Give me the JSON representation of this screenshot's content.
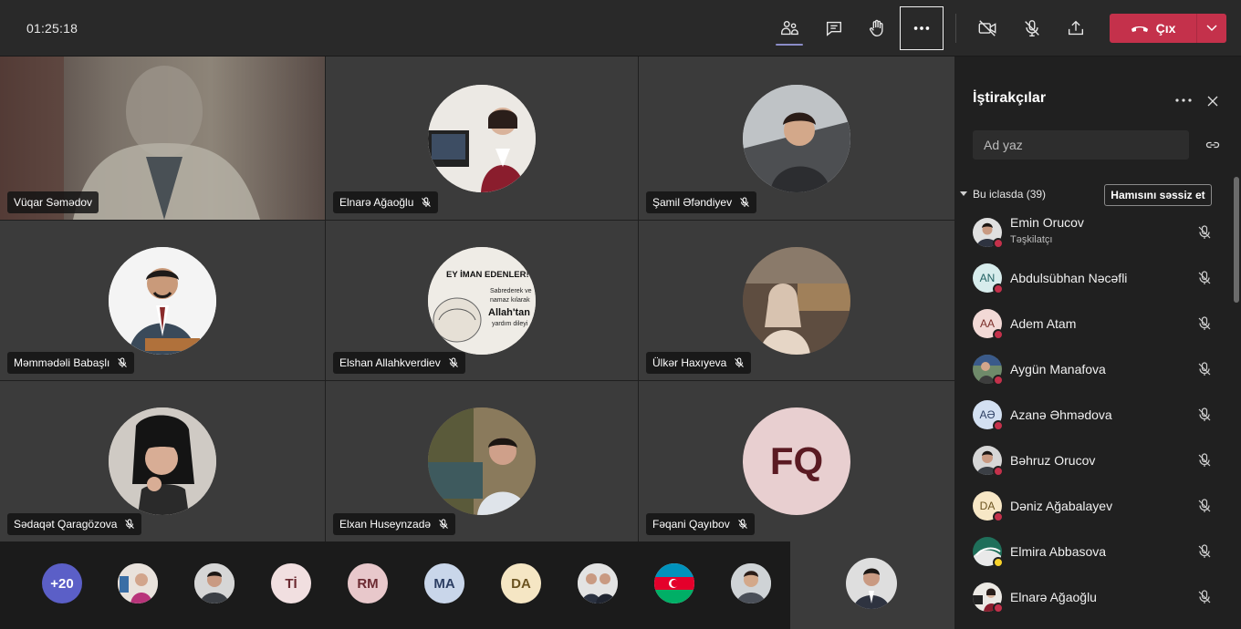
{
  "toolbar": {
    "timer": "01:25:18",
    "leave_label": "Çıx"
  },
  "tiles": [
    {
      "name": "Vüqar Səmədov",
      "type": "video",
      "muted": false
    },
    {
      "name": "Elnarə Ağaoğlu",
      "type": "photo",
      "muted": true
    },
    {
      "name": "Şamil Əfəndiyev",
      "type": "photo",
      "muted": true
    },
    {
      "name": "Məmmədəli Babaşlı",
      "type": "photo",
      "muted": true
    },
    {
      "name": "Elshan Allahkverdiev",
      "type": "photo",
      "muted": true
    },
    {
      "name": "Ülkər Haxıyeva",
      "type": "photo",
      "muted": true
    },
    {
      "name": "Sədaqət Qaragözova",
      "type": "photo",
      "muted": true
    },
    {
      "name": "Elxan Huseynzadə",
      "type": "photo",
      "muted": true
    },
    {
      "name": "Fəqani Qayıbov",
      "type": "initials",
      "initials": "FQ",
      "muted": true
    }
  ],
  "tile_graphics": {
    "poster_line1": "EY İMAN EDENLER!",
    "poster_line2": "Sabrederek ve",
    "poster_line3": "namaz kılarak",
    "poster_line4": "Allah'tan",
    "poster_line5": "yardım dileyi"
  },
  "strip": {
    "overflow_label": "+20",
    "avatars": [
      {
        "kind": "photo"
      },
      {
        "kind": "photo"
      },
      {
        "kind": "initials",
        "text": "Tİ",
        "bg": "#f1dfe0",
        "fg": "#6b2a31"
      },
      {
        "kind": "initials",
        "text": "RM",
        "bg": "#e8c8cb",
        "fg": "#6b2a31"
      },
      {
        "kind": "initials",
        "text": "MA",
        "bg": "#c9d6ea",
        "fg": "#2c3e63"
      },
      {
        "kind": "initials",
        "text": "DA",
        "bg": "#f5e6c4",
        "fg": "#6b5320"
      },
      {
        "kind": "photo"
      },
      {
        "kind": "flag"
      },
      {
        "kind": "photo"
      }
    ]
  },
  "panel": {
    "title": "İştirakçılar",
    "search_placeholder": "Ad yaz",
    "section_label": "Bu iclasda (39)",
    "mute_all_label": "Hamısını səssiz et",
    "participants": [
      {
        "name": "Emin Orucov",
        "role": "Təşkilatçı",
        "avatar": "photo"
      },
      {
        "name": "Abdulsübhan Nəcəfli",
        "initials": "AN",
        "bg": "#d7ecec",
        "fg": "#1f5f60"
      },
      {
        "name": "Adem Atam",
        "initials": "AA",
        "bg": "#f2d9d6",
        "fg": "#7a2d28"
      },
      {
        "name": "Aygün Manafova",
        "avatar": "photo"
      },
      {
        "name": "Azanə Əhmədova",
        "initials": "AƏ",
        "bg": "#d3e0f2",
        "fg": "#2c3e63"
      },
      {
        "name": "Bəhruz Orucov",
        "avatar": "photo"
      },
      {
        "name": "Dəniz Ağabalayev",
        "initials": "DA",
        "bg": "#f7e7c6",
        "fg": "#6b5320"
      },
      {
        "name": "Elmira Abbasova",
        "avatar": "photo",
        "status": "away"
      },
      {
        "name": "Elnarə Ağaoğlu",
        "avatar": "photo"
      }
    ]
  },
  "colors": {
    "accent": "#8b8cc7",
    "leave": "#c4314b",
    "busy": "#c4314b",
    "away": "#f8d22a"
  }
}
